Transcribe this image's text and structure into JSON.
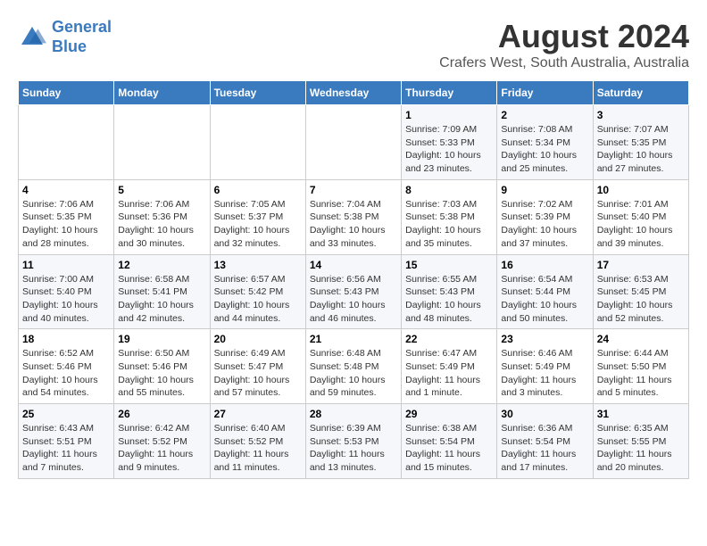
{
  "header": {
    "logo_line1": "General",
    "logo_line2": "Blue",
    "main_title": "August 2024",
    "subtitle": "Crafers West, South Australia, Australia"
  },
  "weekdays": [
    "Sunday",
    "Monday",
    "Tuesday",
    "Wednesday",
    "Thursday",
    "Friday",
    "Saturday"
  ],
  "weeks": [
    [
      {
        "day": "",
        "info": ""
      },
      {
        "day": "",
        "info": ""
      },
      {
        "day": "",
        "info": ""
      },
      {
        "day": "",
        "info": ""
      },
      {
        "day": "1",
        "info": "Sunrise: 7:09 AM\nSunset: 5:33 PM\nDaylight: 10 hours\nand 23 minutes."
      },
      {
        "day": "2",
        "info": "Sunrise: 7:08 AM\nSunset: 5:34 PM\nDaylight: 10 hours\nand 25 minutes."
      },
      {
        "day": "3",
        "info": "Sunrise: 7:07 AM\nSunset: 5:35 PM\nDaylight: 10 hours\nand 27 minutes."
      }
    ],
    [
      {
        "day": "4",
        "info": "Sunrise: 7:06 AM\nSunset: 5:35 PM\nDaylight: 10 hours\nand 28 minutes."
      },
      {
        "day": "5",
        "info": "Sunrise: 7:06 AM\nSunset: 5:36 PM\nDaylight: 10 hours\nand 30 minutes."
      },
      {
        "day": "6",
        "info": "Sunrise: 7:05 AM\nSunset: 5:37 PM\nDaylight: 10 hours\nand 32 minutes."
      },
      {
        "day": "7",
        "info": "Sunrise: 7:04 AM\nSunset: 5:38 PM\nDaylight: 10 hours\nand 33 minutes."
      },
      {
        "day": "8",
        "info": "Sunrise: 7:03 AM\nSunset: 5:38 PM\nDaylight: 10 hours\nand 35 minutes."
      },
      {
        "day": "9",
        "info": "Sunrise: 7:02 AM\nSunset: 5:39 PM\nDaylight: 10 hours\nand 37 minutes."
      },
      {
        "day": "10",
        "info": "Sunrise: 7:01 AM\nSunset: 5:40 PM\nDaylight: 10 hours\nand 39 minutes."
      }
    ],
    [
      {
        "day": "11",
        "info": "Sunrise: 7:00 AM\nSunset: 5:40 PM\nDaylight: 10 hours\nand 40 minutes."
      },
      {
        "day": "12",
        "info": "Sunrise: 6:58 AM\nSunset: 5:41 PM\nDaylight: 10 hours\nand 42 minutes."
      },
      {
        "day": "13",
        "info": "Sunrise: 6:57 AM\nSunset: 5:42 PM\nDaylight: 10 hours\nand 44 minutes."
      },
      {
        "day": "14",
        "info": "Sunrise: 6:56 AM\nSunset: 5:43 PM\nDaylight: 10 hours\nand 46 minutes."
      },
      {
        "day": "15",
        "info": "Sunrise: 6:55 AM\nSunset: 5:43 PM\nDaylight: 10 hours\nand 48 minutes."
      },
      {
        "day": "16",
        "info": "Sunrise: 6:54 AM\nSunset: 5:44 PM\nDaylight: 10 hours\nand 50 minutes."
      },
      {
        "day": "17",
        "info": "Sunrise: 6:53 AM\nSunset: 5:45 PM\nDaylight: 10 hours\nand 52 minutes."
      }
    ],
    [
      {
        "day": "18",
        "info": "Sunrise: 6:52 AM\nSunset: 5:46 PM\nDaylight: 10 hours\nand 54 minutes."
      },
      {
        "day": "19",
        "info": "Sunrise: 6:50 AM\nSunset: 5:46 PM\nDaylight: 10 hours\nand 55 minutes."
      },
      {
        "day": "20",
        "info": "Sunrise: 6:49 AM\nSunset: 5:47 PM\nDaylight: 10 hours\nand 57 minutes."
      },
      {
        "day": "21",
        "info": "Sunrise: 6:48 AM\nSunset: 5:48 PM\nDaylight: 10 hours\nand 59 minutes."
      },
      {
        "day": "22",
        "info": "Sunrise: 6:47 AM\nSunset: 5:49 PM\nDaylight: 11 hours\nand 1 minute."
      },
      {
        "day": "23",
        "info": "Sunrise: 6:46 AM\nSunset: 5:49 PM\nDaylight: 11 hours\nand 3 minutes."
      },
      {
        "day": "24",
        "info": "Sunrise: 6:44 AM\nSunset: 5:50 PM\nDaylight: 11 hours\nand 5 minutes."
      }
    ],
    [
      {
        "day": "25",
        "info": "Sunrise: 6:43 AM\nSunset: 5:51 PM\nDaylight: 11 hours\nand 7 minutes."
      },
      {
        "day": "26",
        "info": "Sunrise: 6:42 AM\nSunset: 5:52 PM\nDaylight: 11 hours\nand 9 minutes."
      },
      {
        "day": "27",
        "info": "Sunrise: 6:40 AM\nSunset: 5:52 PM\nDaylight: 11 hours\nand 11 minutes."
      },
      {
        "day": "28",
        "info": "Sunrise: 6:39 AM\nSunset: 5:53 PM\nDaylight: 11 hours\nand 13 minutes."
      },
      {
        "day": "29",
        "info": "Sunrise: 6:38 AM\nSunset: 5:54 PM\nDaylight: 11 hours\nand 15 minutes."
      },
      {
        "day": "30",
        "info": "Sunrise: 6:36 AM\nSunset: 5:54 PM\nDaylight: 11 hours\nand 17 minutes."
      },
      {
        "day": "31",
        "info": "Sunrise: 6:35 AM\nSunset: 5:55 PM\nDaylight: 11 hours\nand 20 minutes."
      }
    ]
  ]
}
